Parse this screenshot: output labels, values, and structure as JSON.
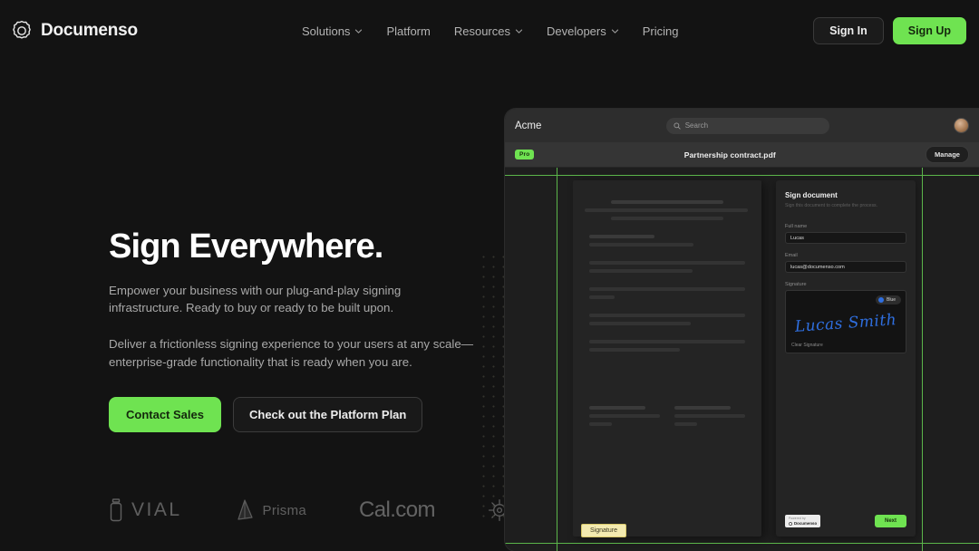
{
  "theme": {
    "background": "#131313",
    "accent_green": "#6fe351",
    "guide_green": "#5bb54a",
    "signature_blue": "#2f6fe0",
    "signature_field_yellow": "#f3eab0"
  },
  "nav": {
    "brand": "Documenso",
    "brand_icon": "documenso-logo-icon",
    "links": [
      {
        "label": "Solutions",
        "has_chevron": true
      },
      {
        "label": "Platform",
        "has_chevron": false
      },
      {
        "label": "Resources",
        "has_chevron": true
      },
      {
        "label": "Developers",
        "has_chevron": true
      },
      {
        "label": "Pricing",
        "has_chevron": false
      }
    ],
    "sign_in": "Sign In",
    "sign_up": "Sign Up"
  },
  "hero": {
    "heading": "Sign Everywhere.",
    "paragraph_1": "Empower your business with our plug-and-play signing infrastructure. Ready to buy or ready to be built upon.",
    "paragraph_2": "Deliver a frictionless signing experience to your users at any scale—enterprise-grade functionality that is ready when you are.",
    "cta_primary": "Contact Sales",
    "cta_secondary": "Check out the Platform Plan"
  },
  "logos": [
    {
      "name": "VIAL",
      "icon": "vial-icon"
    },
    {
      "name": "Prisma",
      "icon": "prisma-prism-icon"
    },
    {
      "name": "Cal.com",
      "icon": "none"
    },
    {
      "name": "",
      "icon": "helm-wheel-icon"
    }
  ],
  "mockup": {
    "topbar": {
      "brand": "Acme",
      "search_placeholder": "Search",
      "search_icon": "search-icon",
      "avatar": "user-avatar"
    },
    "subbar": {
      "badge": "Pro",
      "filename": "Partnership contract.pdf",
      "manage": "Manage"
    },
    "document": {
      "signature_field_label": "Signature"
    },
    "sign_panel": {
      "title": "Sign document",
      "subtitle": "Sign this document to complete the process.",
      "full_name_label": "Full name",
      "full_name_value": "Lucas",
      "email_label": "Email",
      "email_value": "lucas@documenso.com",
      "signature_label": "Signature",
      "color_option": "Blue",
      "signature_text": "Lucas Smith",
      "clear_signature": "Clear Signature",
      "powered_by_top": "Powered by",
      "powered_by_bottom": "Documenso",
      "next_button": "Next"
    }
  }
}
